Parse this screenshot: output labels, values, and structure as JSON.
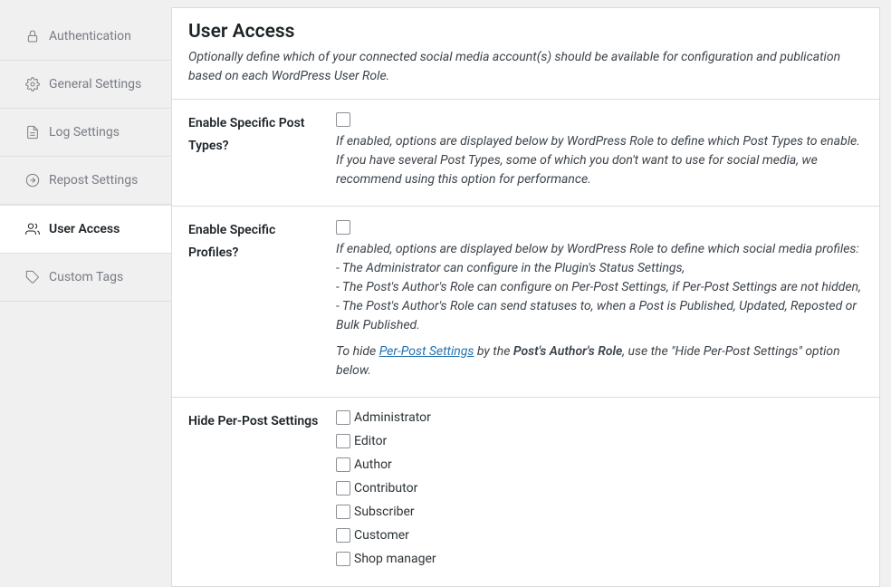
{
  "sidebar": {
    "items": [
      {
        "label": "Authentication"
      },
      {
        "label": "General Settings"
      },
      {
        "label": "Log Settings"
      },
      {
        "label": "Repost Settings"
      },
      {
        "label": "User Access"
      },
      {
        "label": "Custom Tags"
      }
    ]
  },
  "header": {
    "title": "User Access",
    "description": "Optionally define which of your connected social media account(s) should be available for configuration and publication based on each WordPress User Role."
  },
  "sections": {
    "enable_post_types": {
      "label": "Enable Specific Post Types?",
      "help": "If enabled, options are displayed below by WordPress Role to define which Post Types to enable. If you have several Post Types, some of which you don't want to use for social media, we recommend using this option for performance."
    },
    "enable_profiles": {
      "label": "Enable Specific Profiles?",
      "help_intro": "If enabled, options are displayed below by WordPress Role to define which social media profiles:",
      "help_line1": "- The Administrator can configure in the Plugin's Status Settings,",
      "help_line2": "- The Post's Author's Role can configure on Per-Post Settings, if Per-Post Settings are not hidden,",
      "help_line3": "- The Post's Author's Role can send statuses to, when a Post is Published, Updated, Reposted or Bulk Published.",
      "help2_pre": "To hide ",
      "help2_link": "Per-Post Settings",
      "help2_mid": " by the ",
      "help2_strong": "Post's Author's Role",
      "help2_post": ", use the \"Hide Per-Post Settings\" option below."
    },
    "hide_per_post": {
      "label": "Hide Per-Post Settings",
      "roles": [
        "Administrator",
        "Editor",
        "Author",
        "Contributor",
        "Subscriber",
        "Customer",
        "Shop manager"
      ]
    }
  }
}
